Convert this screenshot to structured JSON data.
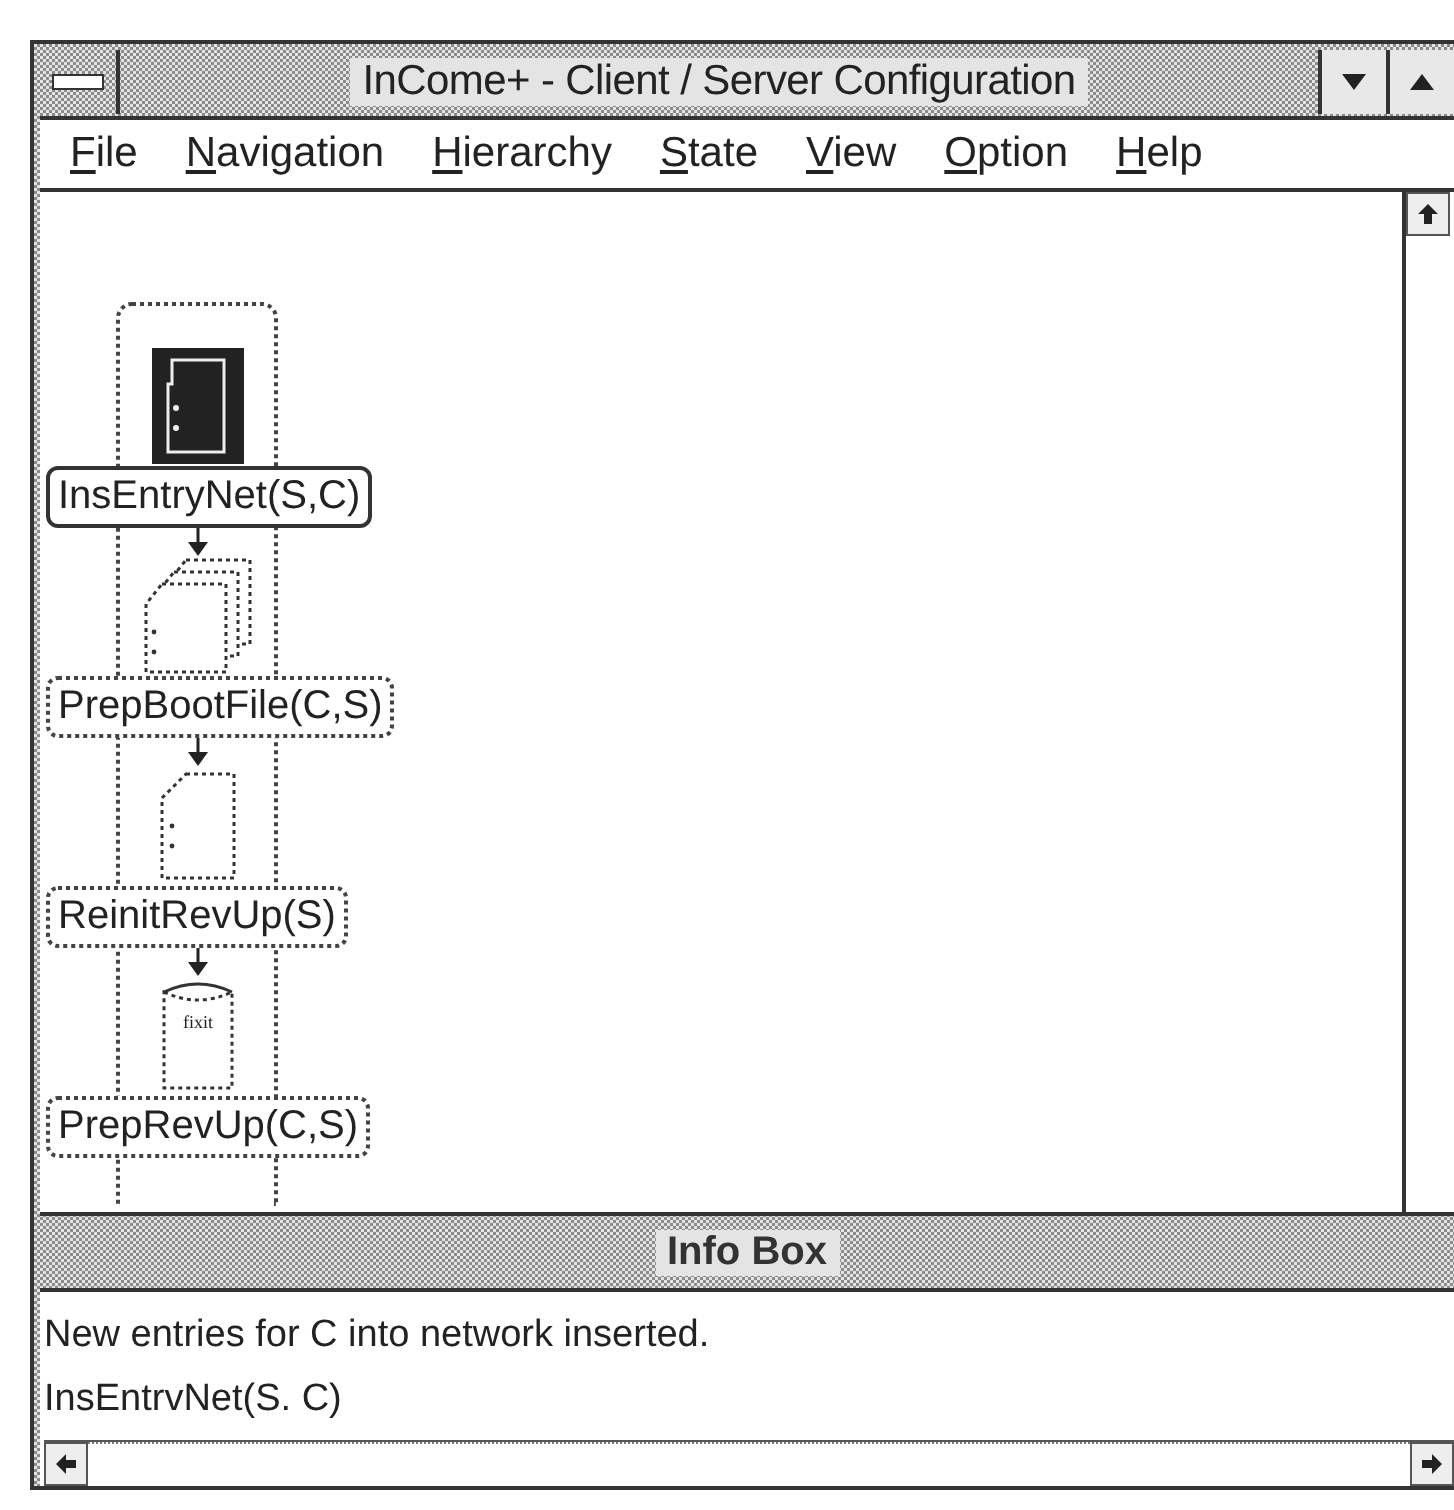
{
  "window": {
    "title": "InCome+ - Client / Server Configuration"
  },
  "menu": [
    {
      "label": "File"
    },
    {
      "label": "Navigation"
    },
    {
      "label": "Hierarchy"
    },
    {
      "label": "State"
    },
    {
      "label": "View"
    },
    {
      "label": "Option"
    },
    {
      "label": "Help"
    }
  ],
  "diagram": {
    "nodes": [
      {
        "label": "InsEntryNet(S,C)",
        "kind": "filled-document",
        "selected": true
      },
      {
        "label": "PrepBootFile(C,S)",
        "kind": "document-stack",
        "selected": false
      },
      {
        "label": "ReinitRevUp(S)",
        "kind": "document",
        "selected": false
      },
      {
        "label": "PrepRevUp(C,S)",
        "kind": "database",
        "icon_text": "fixit",
        "selected": false
      }
    ]
  },
  "info_box": {
    "title": "Info Box",
    "lines": [
      "New entries for C into network inserted.",
      "InsEntrvNet(S. C)"
    ]
  }
}
